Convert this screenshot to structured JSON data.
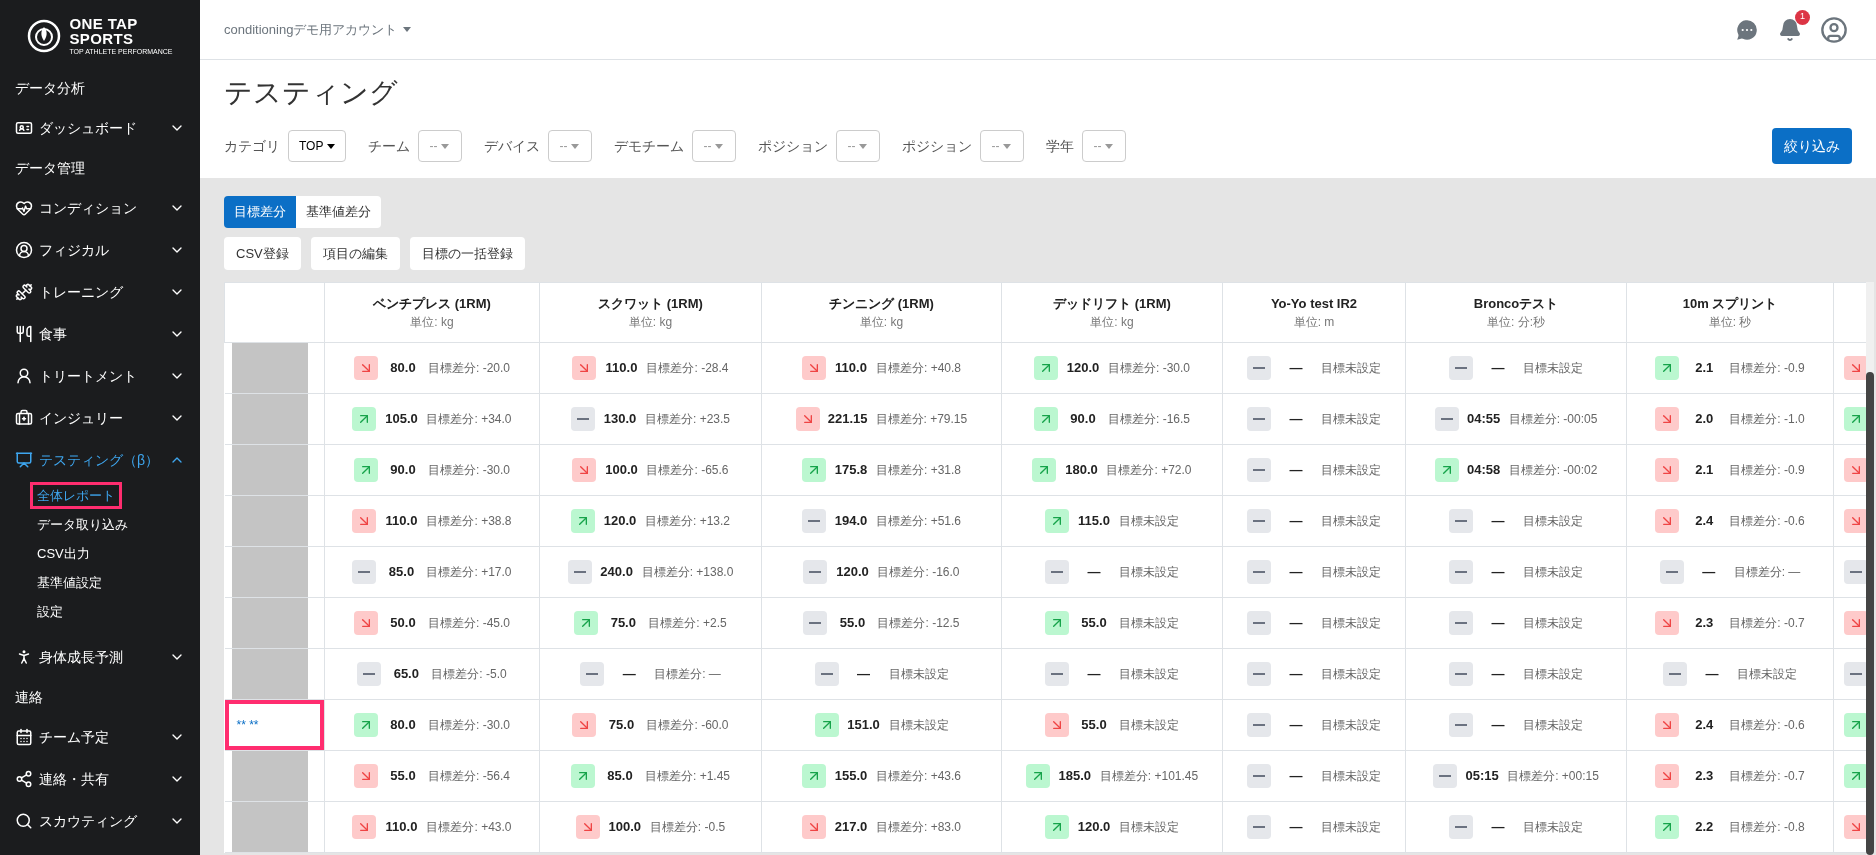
{
  "logo": {
    "lines": [
      "ONE TAP",
      "SPORTS"
    ],
    "tagline": "TOP ATHLETE PERFORMANCE"
  },
  "sidebar": {
    "items": [
      {
        "kind": "section",
        "label": "データ分析"
      },
      {
        "kind": "menu",
        "label": "ダッシュボード",
        "expanded": false,
        "selected": false
      },
      {
        "kind": "section",
        "label": "データ管理"
      },
      {
        "kind": "menu",
        "label": "コンディション",
        "expanded": false,
        "selected": false
      },
      {
        "kind": "menu",
        "label": "フィジカル",
        "expanded": false,
        "selected": false
      },
      {
        "kind": "menu",
        "label": "トレーニング",
        "expanded": false,
        "selected": false
      },
      {
        "kind": "menu",
        "label": "食事",
        "expanded": false,
        "selected": false
      },
      {
        "kind": "menu",
        "label": "トリートメント",
        "expanded": false,
        "selected": false
      },
      {
        "kind": "menu",
        "label": "インジュリー",
        "expanded": false,
        "selected": false
      },
      {
        "kind": "menu",
        "label": "テスティング（β）",
        "expanded": true,
        "selected": true,
        "children": [
          {
            "label": "全体レポート",
            "selected": true,
            "highlighted": true
          },
          {
            "label": "データ取り込み",
            "selected": false,
            "highlighted": false
          },
          {
            "label": "CSV出力",
            "selected": false,
            "highlighted": false
          },
          {
            "label": "基準値設定",
            "selected": false,
            "highlighted": false
          },
          {
            "label": "設定",
            "selected": false,
            "highlighted": false
          }
        ]
      },
      {
        "kind": "menu",
        "label": "身体成長予測",
        "expanded": false,
        "selected": false
      },
      {
        "kind": "section",
        "label": "連絡"
      },
      {
        "kind": "menu",
        "label": "チーム予定",
        "expanded": false,
        "selected": false
      },
      {
        "kind": "menu",
        "label": "連絡・共有",
        "expanded": false,
        "selected": false
      },
      {
        "kind": "menu",
        "label": "スカウティング",
        "expanded": false,
        "selected": false
      }
    ]
  },
  "header": {
    "account": "conditioningデモ用アカウント",
    "notification_count": "1"
  },
  "page_title": "テスティング",
  "filters": [
    {
      "label": "カテゴリ",
      "value": "TOP"
    },
    {
      "label": "チーム",
      "value": "--"
    },
    {
      "label": "デバイス",
      "value": "--"
    },
    {
      "label": "デモチーム",
      "value": "--"
    },
    {
      "label": "ポジション",
      "value": "--"
    },
    {
      "label": "ポジション",
      "value": "--"
    },
    {
      "label": "学年",
      "value": "--"
    }
  ],
  "filter_button": "絞り込み",
  "mode_tabs": [
    {
      "label": "目標差分",
      "selected": true
    },
    {
      "label": "基準値差分",
      "selected": false
    }
  ],
  "actions": [
    "CSV登録",
    "項目の編集",
    "目標の一括登録"
  ],
  "table": {
    "columns": [
      {
        "title": "ベンチプレス (1RM)",
        "unit": "単位: kg"
      },
      {
        "title": "スクワット (1RM)",
        "unit": "単位: kg"
      },
      {
        "title": "チンニング (1RM)",
        "unit": "単位: kg"
      },
      {
        "title": "デッドリフト (1RM)",
        "unit": "単位: kg"
      },
      {
        "title": "Yo-Yo test IR2",
        "unit": "単位: m"
      },
      {
        "title": "Broncoテスト",
        "unit": "単位: 分:秒"
      },
      {
        "title": "10m スプリント",
        "unit": "単位: 秒"
      }
    ],
    "rows": [
      {
        "redacted": true,
        "highlighted": false,
        "cells": [
          {
            "kind": "down",
            "value": "80.0",
            "diff": "目標差分: -20.0"
          },
          {
            "kind": "down",
            "value": "110.0",
            "diff": "目標差分: -28.4"
          },
          {
            "kind": "down",
            "value": "110.0",
            "diff": "目標差分: +40.8"
          },
          {
            "kind": "up",
            "value": "120.0",
            "diff": "目標差分: -30.0"
          },
          {
            "kind": "flat",
            "value": "—",
            "diff": "目標未設定"
          },
          {
            "kind": "flat",
            "value": "—",
            "diff": "目標未設定"
          },
          {
            "kind": "up",
            "value": "2.1",
            "diff": "目標差分: -0.9"
          },
          {
            "kind": "down"
          }
        ]
      },
      {
        "redacted": true,
        "highlighted": false,
        "cells": [
          {
            "kind": "up",
            "value": "105.0",
            "diff": "目標差分: +34.0"
          },
          {
            "kind": "flat",
            "value": "130.0",
            "diff": "目標差分: +23.5"
          },
          {
            "kind": "down",
            "value": "221.15",
            "diff": "目標差分: +79.15"
          },
          {
            "kind": "up",
            "value": "90.0",
            "diff": "目標差分: -16.5"
          },
          {
            "kind": "flat",
            "value": "—",
            "diff": "目標未設定"
          },
          {
            "kind": "flat",
            "value": "04:55",
            "diff": "目標差分: -00:05"
          },
          {
            "kind": "down",
            "value": "2.0",
            "diff": "目標差分: -1.0"
          },
          {
            "kind": "up"
          }
        ]
      },
      {
        "redacted": true,
        "highlighted": false,
        "cells": [
          {
            "kind": "up",
            "value": "90.0",
            "diff": "目標差分: -30.0"
          },
          {
            "kind": "down",
            "value": "100.0",
            "diff": "目標差分: -65.6"
          },
          {
            "kind": "up",
            "value": "175.8",
            "diff": "目標差分: +31.8"
          },
          {
            "kind": "up",
            "value": "180.0",
            "diff": "目標差分: +72.0"
          },
          {
            "kind": "flat",
            "value": "—",
            "diff": "目標未設定"
          },
          {
            "kind": "up",
            "value": "04:58",
            "diff": "目標差分: -00:02"
          },
          {
            "kind": "down",
            "value": "2.1",
            "diff": "目標差分: -0.9"
          },
          {
            "kind": "down"
          }
        ]
      },
      {
        "redacted": true,
        "highlighted": false,
        "cells": [
          {
            "kind": "down",
            "value": "110.0",
            "diff": "目標差分: +38.8"
          },
          {
            "kind": "up",
            "value": "120.0",
            "diff": "目標差分: +13.2"
          },
          {
            "kind": "flat",
            "value": "194.0",
            "diff": "目標差分: +51.6"
          },
          {
            "kind": "up",
            "value": "115.0",
            "diff": "目標未設定"
          },
          {
            "kind": "flat",
            "value": "—",
            "diff": "目標未設定"
          },
          {
            "kind": "flat",
            "value": "—",
            "diff": "目標未設定"
          },
          {
            "kind": "down",
            "value": "2.4",
            "diff": "目標差分: -0.6"
          },
          {
            "kind": "down"
          }
        ]
      },
      {
        "redacted": true,
        "highlighted": false,
        "cells": [
          {
            "kind": "flat",
            "value": "85.0",
            "diff": "目標差分: +17.0"
          },
          {
            "kind": "flat",
            "value": "240.0",
            "diff": "目標差分: +138.0"
          },
          {
            "kind": "flat",
            "value": "120.0",
            "diff": "目標差分: -16.0"
          },
          {
            "kind": "flat",
            "value": "—",
            "diff": "目標未設定"
          },
          {
            "kind": "flat",
            "value": "—",
            "diff": "目標未設定"
          },
          {
            "kind": "flat",
            "value": "—",
            "diff": "目標未設定"
          },
          {
            "kind": "flat",
            "value": "—",
            "diff": "目標差分: —"
          },
          {
            "kind": "flat"
          }
        ]
      },
      {
        "redacted": true,
        "highlighted": false,
        "cells": [
          {
            "kind": "down",
            "value": "50.0",
            "diff": "目標差分: -45.0"
          },
          {
            "kind": "up",
            "value": "75.0",
            "diff": "目標差分: +2.5"
          },
          {
            "kind": "flat",
            "value": "55.0",
            "diff": "目標差分: -12.5"
          },
          {
            "kind": "up",
            "value": "55.0",
            "diff": "目標未設定"
          },
          {
            "kind": "flat",
            "value": "—",
            "diff": "目標未設定"
          },
          {
            "kind": "flat",
            "value": "—",
            "diff": "目標未設定"
          },
          {
            "kind": "down",
            "value": "2.3",
            "diff": "目標差分: -0.7"
          },
          {
            "kind": "down"
          }
        ]
      },
      {
        "redacted": true,
        "highlighted": false,
        "cells": [
          {
            "kind": "flat",
            "value": "65.0",
            "diff": "目標差分: -5.0"
          },
          {
            "kind": "flat",
            "value": "—",
            "diff": "目標差分: —"
          },
          {
            "kind": "flat",
            "value": "—",
            "diff": "目標未設定"
          },
          {
            "kind": "flat",
            "value": "—",
            "diff": "目標未設定"
          },
          {
            "kind": "flat",
            "value": "—",
            "diff": "目標未設定"
          },
          {
            "kind": "flat",
            "value": "—",
            "diff": "目標未設定"
          },
          {
            "kind": "flat",
            "value": "—",
            "diff": "目標未設定"
          },
          {
            "kind": "flat"
          }
        ]
      },
      {
        "redacted": false,
        "name": "** **",
        "highlighted": true,
        "cells": [
          {
            "kind": "up",
            "value": "80.0",
            "diff": "目標差分: -30.0"
          },
          {
            "kind": "down",
            "value": "75.0",
            "diff": "目標差分: -60.0"
          },
          {
            "kind": "up",
            "value": "151.0",
            "diff": "目標未設定"
          },
          {
            "kind": "down",
            "value": "55.0",
            "diff": "目標未設定"
          },
          {
            "kind": "flat",
            "value": "—",
            "diff": "目標未設定"
          },
          {
            "kind": "flat",
            "value": "—",
            "diff": "目標未設定"
          },
          {
            "kind": "down",
            "value": "2.4",
            "diff": "目標差分: -0.6"
          },
          {
            "kind": "up"
          }
        ]
      },
      {
        "redacted": true,
        "highlighted": false,
        "cells": [
          {
            "kind": "down",
            "value": "55.0",
            "diff": "目標差分: -56.4"
          },
          {
            "kind": "up",
            "value": "85.0",
            "diff": "目標差分: +1.45"
          },
          {
            "kind": "up",
            "value": "155.0",
            "diff": "目標差分: +43.6"
          },
          {
            "kind": "up",
            "value": "185.0",
            "diff": "目標差分: +101.45"
          },
          {
            "kind": "flat",
            "value": "—",
            "diff": "目標未設定"
          },
          {
            "kind": "flat",
            "value": "05:15",
            "diff": "目標差分: +00:15"
          },
          {
            "kind": "down",
            "value": "2.3",
            "diff": "目標差分: -0.7"
          },
          {
            "kind": "up"
          }
        ]
      },
      {
        "redacted": true,
        "highlighted": false,
        "cells": [
          {
            "kind": "down",
            "value": "110.0",
            "diff": "目標差分: +43.0"
          },
          {
            "kind": "down",
            "value": "100.0",
            "diff": "目標差分: -0.5"
          },
          {
            "kind": "down",
            "value": "217.0",
            "diff": "目標差分: +83.0"
          },
          {
            "kind": "up",
            "value": "120.0",
            "diff": "目標未設定"
          },
          {
            "kind": "flat",
            "value": "—",
            "diff": "目標未設定"
          },
          {
            "kind": "flat",
            "value": "—",
            "diff": "目標未設定"
          },
          {
            "kind": "up",
            "value": "2.2",
            "diff": "目標差分: -0.8"
          },
          {
            "kind": "down"
          }
        ]
      }
    ]
  }
}
